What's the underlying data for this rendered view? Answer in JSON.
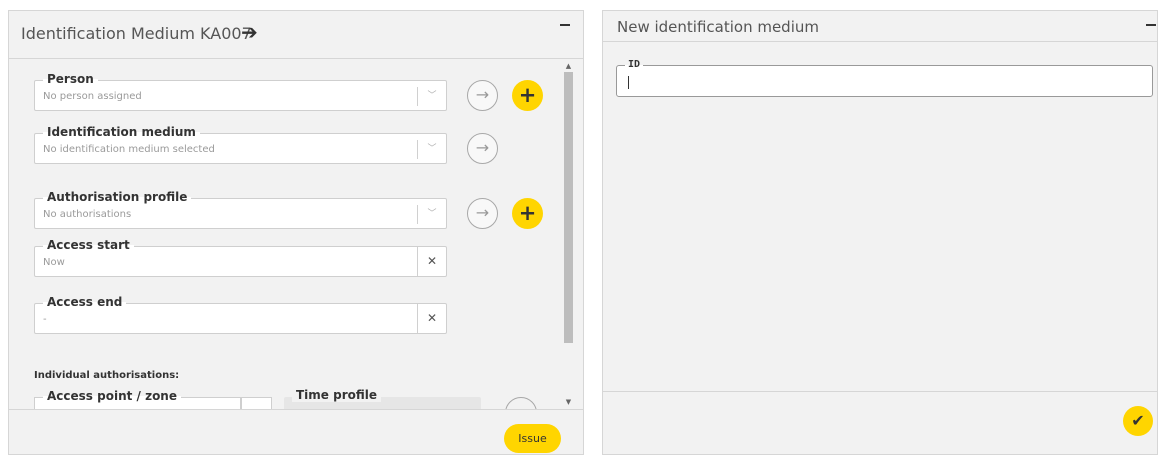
{
  "left_panel": {
    "title": "Identification Medium KA007",
    "header_arrow": "➔",
    "fields": {
      "person": {
        "label": "Person",
        "value": "No person assigned"
      },
      "identification_medium": {
        "label": "Identification medium",
        "value": "No identification medium selected"
      },
      "authorisation_profile": {
        "label": "Authorisation profile",
        "value": "No authorisations"
      },
      "access_start": {
        "label": "Access start",
        "value": "Now"
      },
      "access_end": {
        "label": "Access end",
        "value": "-"
      }
    },
    "individual_auth_heading": "Individual authorisations:",
    "access_point_label": "Access point / zone",
    "time_profile_label": "Time profile",
    "issue_label": "Issue",
    "icons": {
      "dropdown": "chevron-down-icon",
      "clear": "✕",
      "navigate": "→",
      "add": "+"
    }
  },
  "right_panel": {
    "title": "New identification medium",
    "id_label": "ID",
    "id_value": "",
    "confirm_icon": "✔"
  },
  "colors": {
    "accent": "#ffd500",
    "panel_bg": "#f2f2f2",
    "text": "#333333"
  }
}
